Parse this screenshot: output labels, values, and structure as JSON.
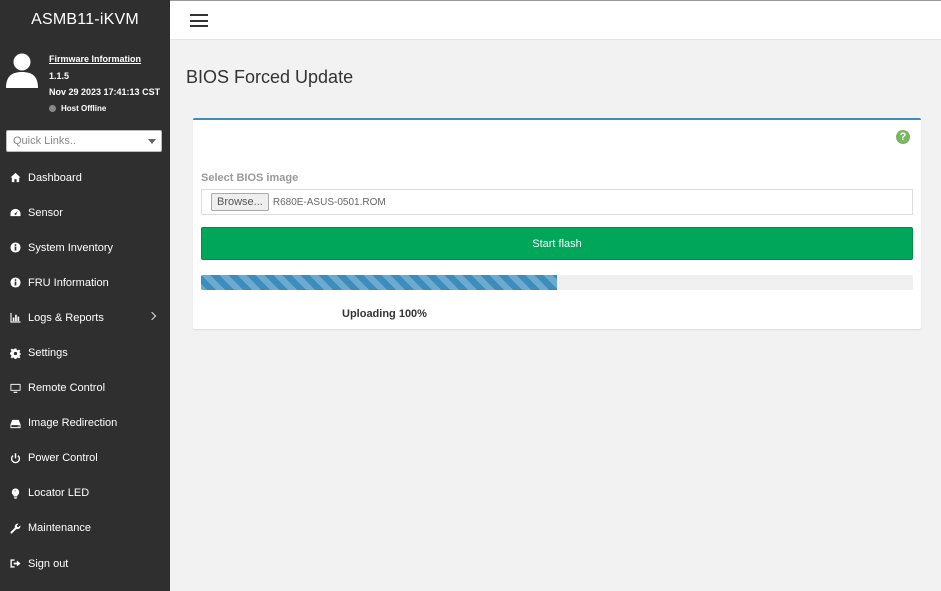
{
  "app": {
    "brand": "ASMB11-iKVM"
  },
  "user_panel": {
    "firmware_label": "Firmware Information",
    "firmware_version": "1.1.5",
    "build_date": "Nov 29 2023 17:41:13 CST",
    "host_status": "Host Offline",
    "host_status_color": "#8a8a8a"
  },
  "quick_links": {
    "placeholder": "Quick Links.."
  },
  "nav": {
    "items": [
      {
        "label": "Dashboard",
        "icon": "home-icon"
      },
      {
        "label": "Sensor",
        "icon": "tachometer-icon"
      },
      {
        "label": "System Inventory",
        "icon": "info-circle-icon"
      },
      {
        "label": "FRU Information",
        "icon": "info-circle-icon"
      },
      {
        "label": "Logs & Reports",
        "icon": "bar-chart-icon",
        "has_submenu": true
      },
      {
        "label": "Settings",
        "icon": "gear-icon"
      },
      {
        "label": "Remote Control",
        "icon": "monitor-icon"
      },
      {
        "label": "Image Redirection",
        "icon": "hdd-icon"
      },
      {
        "label": "Power Control",
        "icon": "power-icon"
      },
      {
        "label": "Locator LED",
        "icon": "lightbulb-icon"
      },
      {
        "label": "Maintenance",
        "icon": "wrench-icon"
      },
      {
        "label": "Sign out",
        "icon": "sign-out-icon"
      }
    ]
  },
  "main": {
    "title": "BIOS Forced Update",
    "select_label": "Select BIOS image",
    "browse_label": "Browse...",
    "file_name": "R680E-ASUS-0501.ROM",
    "start_label": "Start flash",
    "progress_fraction": 0.5,
    "progress_text": "Uploading 100%",
    "help_symbol": "?"
  },
  "colors": {
    "sidebar_bg": "#2f2f2f",
    "accent": "#3c8dbc",
    "start_button": "#00a65a",
    "help_icon": "#7bb663"
  }
}
